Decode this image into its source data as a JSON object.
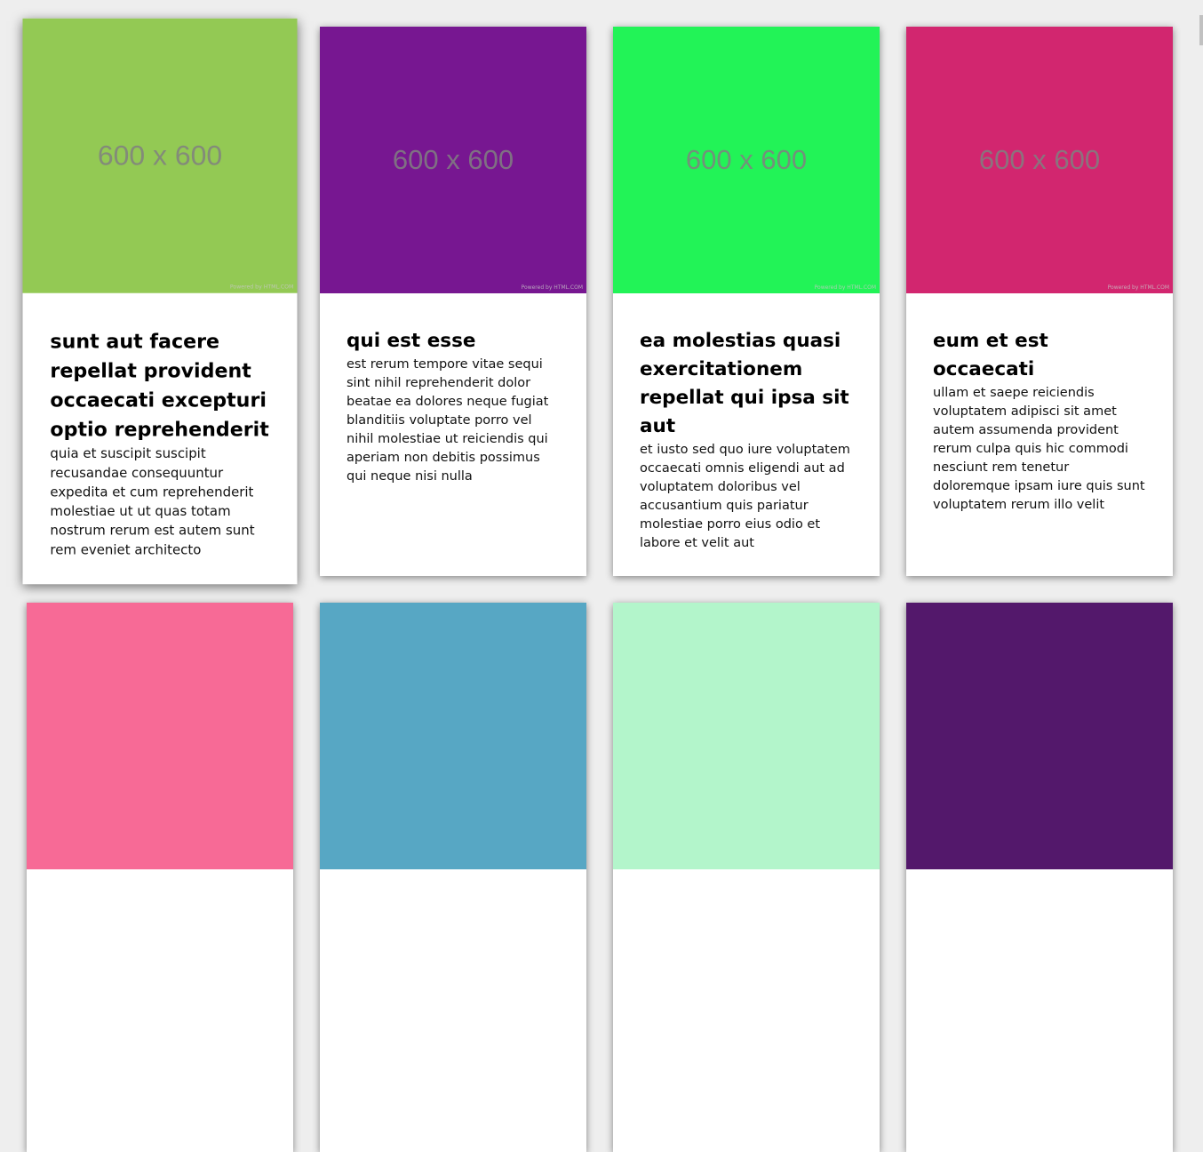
{
  "cards": [
    {
      "image_label": "600 x 600",
      "powered": "Powered by HTML.COM",
      "color": "#93c954",
      "title": "sunt aut facere repellat provident occaecati excepturi optio reprehenderit",
      "body": "quia et suscipit suscipit recusandae consequuntur expedita et cum reprehenderit molestiae ut ut quas totam nostrum rerum est autem sunt rem eveniet architecto"
    },
    {
      "image_label": "600 x 600",
      "powered": "Powered by HTML.COM",
      "color": "#771791",
      "title": "qui est esse",
      "body": "est rerum tempore vitae sequi sint nihil reprehenderit dolor beatae ea dolores neque fugiat blanditiis voluptate porro vel nihil molestiae ut reiciendis qui aperiam non debitis possimus qui neque nisi nulla"
    },
    {
      "image_label": "600 x 600",
      "powered": "Powered by HTML.COM",
      "color": "#22f357",
      "title": "ea molestias quasi exercitationem repellat qui ipsa sit aut",
      "body": "et iusto sed quo iure voluptatem occaecati omnis eligendi aut ad voluptatem doloribus vel accusantium quis pariatur molestiae porro eius odio et labore et velit aut"
    },
    {
      "image_label": "600 x 600",
      "powered": "Powered by HTML.COM",
      "color": "#d2266f",
      "title": "eum et est occaecati",
      "body": "ullam et saepe reiciendis voluptatem adipisci sit amet autem assumenda provident rerum culpa quis hic commodi nesciunt rem tenetur doloremque ipsam iure quis sunt voluptatem rerum illo velit"
    },
    {
      "color": "#f76a96"
    },
    {
      "color": "#57a7c4"
    },
    {
      "color": "#b3f5cb"
    },
    {
      "color": "#53186b"
    }
  ]
}
